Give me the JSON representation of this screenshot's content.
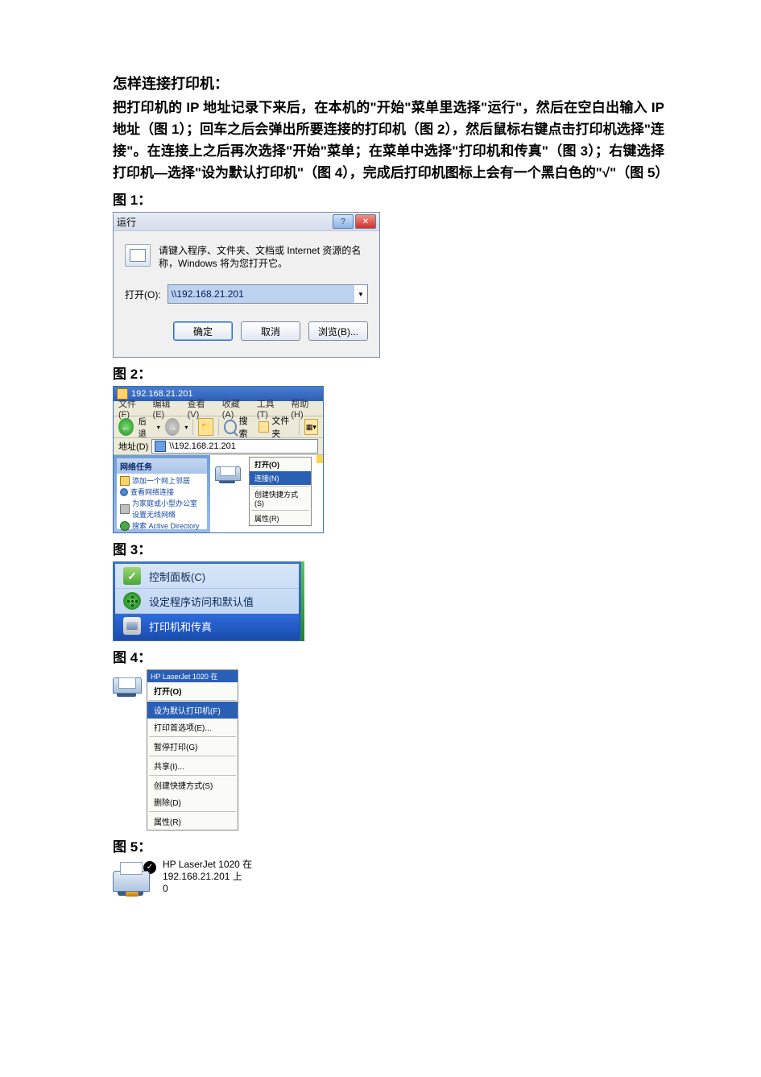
{
  "heading": "怎样连接打印机：",
  "intro": "把打印机的 IP 地址记录下来后，在本机的\"开始\"菜单里选择\"运行\"，然后在空白出输入 IP 地址（图 1）；回车之后会弹出所要连接的打印机（图 2），然后鼠标右键点击打印机选择\"连接\"。在连接上之后再次选择\"开始\"菜单；在菜单中选择\"打印机和传真\"（图 3）；右键选择打印机—选择\"设为默认打印机\"（图 4），完成后打印机图标上会有一个黑白色的\"√\"（图 5）",
  "labels": {
    "fig1": "图 1：",
    "fig2": "图 2：",
    "fig3": "图 3：",
    "fig4": "图 4：",
    "fig5": "图 5："
  },
  "fig1": {
    "title": "运行",
    "desc": "请键入程序、文件夹、文档或 Internet 资源的名称，Windows 将为您打开它。",
    "open_label": "打开(O):",
    "input_value": "\\\\192.168.21.201",
    "ok": "确定",
    "cancel": "取消",
    "browse": "浏览(B)..."
  },
  "fig2": {
    "win_title": "192.168.21.201",
    "menu": {
      "file": "文件(F)",
      "edit": "编辑(E)",
      "view": "查看(V)",
      "fav": "收藏(A)",
      "tools": "工具(T)",
      "help": "帮助(H)"
    },
    "toolbar": {
      "back_label": "后退",
      "search": "搜索",
      "folders": "文件夹"
    },
    "addr_label": "地址(D)",
    "addr_value": "\\\\192.168.21.201",
    "side_header": "网络任务",
    "side_items": [
      "添加一个网上邻居",
      "查看网络连接",
      "为家庭或小型办公室设置无线网络",
      "搜索 Active Directory"
    ],
    "ctx": {
      "open": "打开(O)",
      "connect": "连接(N)",
      "shortcut": "创建快捷方式(S)",
      "props": "属性(R)"
    }
  },
  "fig3": {
    "item1": "控制面板(C)",
    "item2": "设定程序访问和默认值",
    "item3": "打印机和传真"
  },
  "fig4": {
    "header": "HP LaserJet 1020 在",
    "open": "打开(O)",
    "set_default": "设为默认打印机(F)",
    "prefs": "打印首选项(E)...",
    "pause": "暂停打印(G)",
    "share": "共享(I)...",
    "shortcut": "创建快捷方式(S)",
    "delete": "删除(D)",
    "props": "属性(R)"
  },
  "fig5": {
    "line1": "HP LaserJet 1020 在",
    "line2": "192.168.21.201 上",
    "line3": "0"
  }
}
